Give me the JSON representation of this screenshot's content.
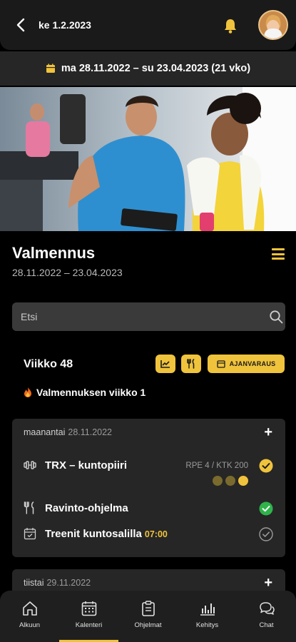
{
  "header": {
    "date": "ke 1.2.2023"
  },
  "period": {
    "range": "ma 28.11.2022 – su 23.04.2023 (21 vko)"
  },
  "section": {
    "title": "Valmennus",
    "dates": "28.11.2022 – 23.04.2023"
  },
  "search": {
    "placeholder": "Etsi"
  },
  "week": {
    "label": "Viikko 48",
    "booking_label": "AJANVARAUS",
    "coaching_week": "Valmennuksen viikko 1"
  },
  "days": [
    {
      "weekday": "maanantai",
      "date": "28.11.2022",
      "items": [
        {
          "title": "TRX – kuntopiiri",
          "rpe": "RPE 4 / KTK 200",
          "status": "done-outline"
        },
        {
          "title": "Ravinto-ohjelma",
          "status": "done-green"
        },
        {
          "title": "Treenit kuntosalilla",
          "time": "07:00",
          "status": "pending"
        }
      ]
    },
    {
      "weekday": "tiistai",
      "date": "29.11.2022"
    }
  ],
  "nav": [
    {
      "label": "Alkuun",
      "icon": "home-icon"
    },
    {
      "label": "Kalenteri",
      "icon": "calendar-icon"
    },
    {
      "label": "Ohjelmat",
      "icon": "clipboard-icon"
    },
    {
      "label": "Kehitys",
      "icon": "chart-icon"
    },
    {
      "label": "Chat",
      "icon": "chat-icon"
    }
  ],
  "colors": {
    "accent": "#f0c33c",
    "success": "#2fb34a",
    "card": "#262626",
    "background": "#000000"
  }
}
